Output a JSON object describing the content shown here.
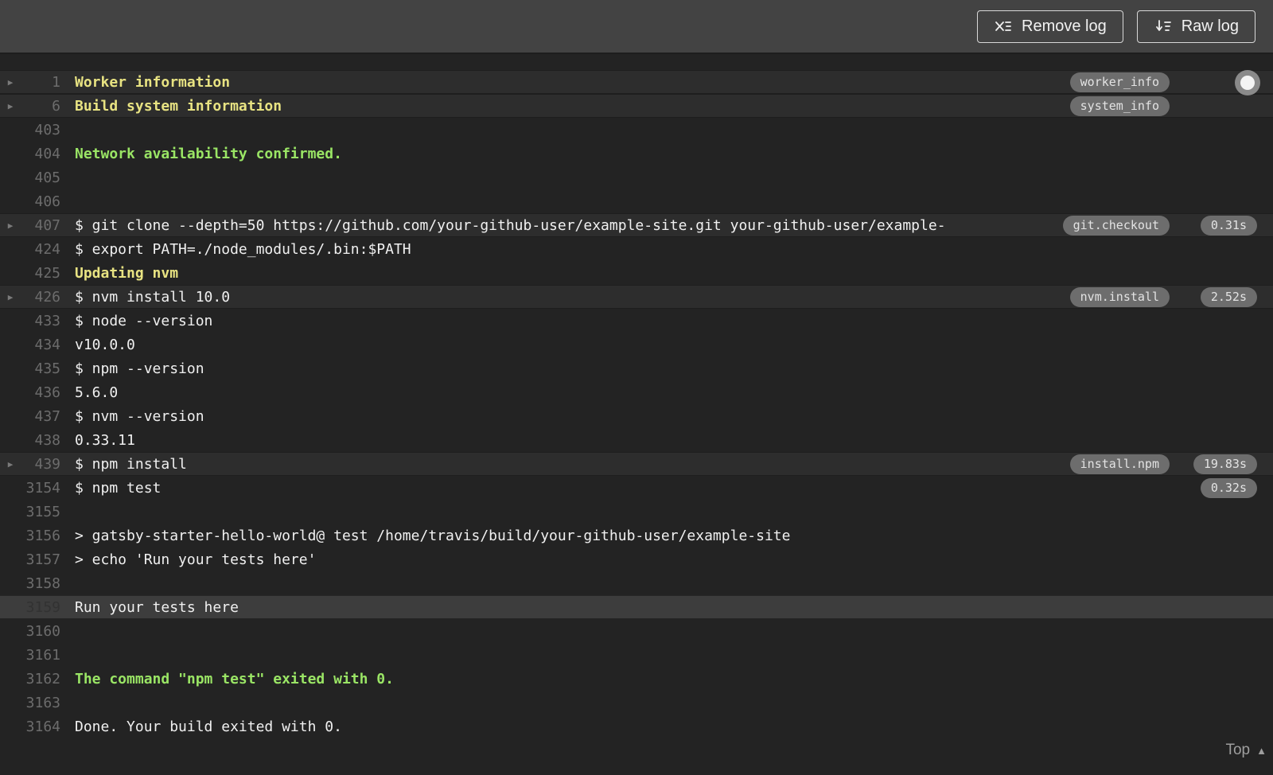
{
  "toolbar": {
    "remove_log_label": "Remove log",
    "raw_log_label": "Raw log"
  },
  "log": {
    "top_link_label": "Top",
    "lines": [
      {
        "num": "1",
        "text": "Worker information",
        "style": "yellow",
        "fold": true,
        "tag": "worker_info",
        "time": null
      },
      {
        "num": "6",
        "text": "Build system information",
        "style": "yellow",
        "fold": true,
        "tag": "system_info",
        "time": null
      },
      {
        "num": "403",
        "text": "",
        "style": "plain"
      },
      {
        "num": "404",
        "text": "Network availability confirmed.",
        "style": "green"
      },
      {
        "num": "405",
        "text": "",
        "style": "plain"
      },
      {
        "num": "406",
        "text": "",
        "style": "plain"
      },
      {
        "num": "407",
        "text": "$ git clone --depth=50 https://github.com/your-github-user/example-site.git your-github-user/example-",
        "style": "plain",
        "fold": true,
        "tag": "git.checkout",
        "time": "0.31s"
      },
      {
        "num": "424",
        "text": "$ export PATH=./node_modules/.bin:$PATH",
        "style": "plain"
      },
      {
        "num": "425",
        "text": "Updating nvm",
        "style": "yellow"
      },
      {
        "num": "426",
        "text": "$ nvm install 10.0",
        "style": "plain",
        "fold": true,
        "tag": "nvm.install",
        "time": "2.52s"
      },
      {
        "num": "433",
        "text": "$ node --version",
        "style": "plain"
      },
      {
        "num": "434",
        "text": "v10.0.0",
        "style": "plain"
      },
      {
        "num": "435",
        "text": "$ npm --version",
        "style": "plain"
      },
      {
        "num": "436",
        "text": "5.6.0",
        "style": "plain"
      },
      {
        "num": "437",
        "text": "$ nvm --version",
        "style": "plain"
      },
      {
        "num": "438",
        "text": "0.33.11",
        "style": "plain"
      },
      {
        "num": "439",
        "text": "$ npm install",
        "style": "plain",
        "fold": true,
        "tag": "install.npm",
        "time": "19.83s"
      },
      {
        "num": "3154",
        "text": "$ npm test",
        "style": "plain",
        "time": "0.32s"
      },
      {
        "num": "3155",
        "text": "",
        "style": "plain"
      },
      {
        "num": "3156",
        "text": "> gatsby-starter-hello-world@ test /home/travis/build/your-github-user/example-site",
        "style": "plain"
      },
      {
        "num": "3157",
        "text": "> echo 'Run your tests here'",
        "style": "plain"
      },
      {
        "num": "3158",
        "text": "",
        "style": "plain"
      },
      {
        "num": "3159",
        "text": "Run your tests here",
        "style": "plain",
        "highlighted": true
      },
      {
        "num": "3160",
        "text": "",
        "style": "plain"
      },
      {
        "num": "3161",
        "text": "",
        "style": "plain"
      },
      {
        "num": "3162",
        "text": "The command \"npm test\" exited with 0.",
        "style": "green"
      },
      {
        "num": "3163",
        "text": "",
        "style": "plain"
      },
      {
        "num": "3164",
        "text": "Done. Your build exited with 0.",
        "style": "plain"
      }
    ]
  },
  "icons": {
    "remove_log": "x-with-list-icon",
    "raw_log": "arrow-down-with-list-icon",
    "fold_toggle": "caret-right-icon",
    "top": "caret-up-icon",
    "scrubber": "circle-knob"
  },
  "colors": {
    "toolbar_bg": "#434343",
    "log_bg": "#232323",
    "fold_row_bg": "#2d2d2d",
    "highlight_row_bg": "#3d3d3d",
    "text": "#f0f0f0",
    "line_number": "#6c6c6c",
    "yellow": "#e8e382",
    "green": "#9ae565",
    "badge_bg": "#6d6d6d",
    "badge_text": "#e3e3e3"
  }
}
